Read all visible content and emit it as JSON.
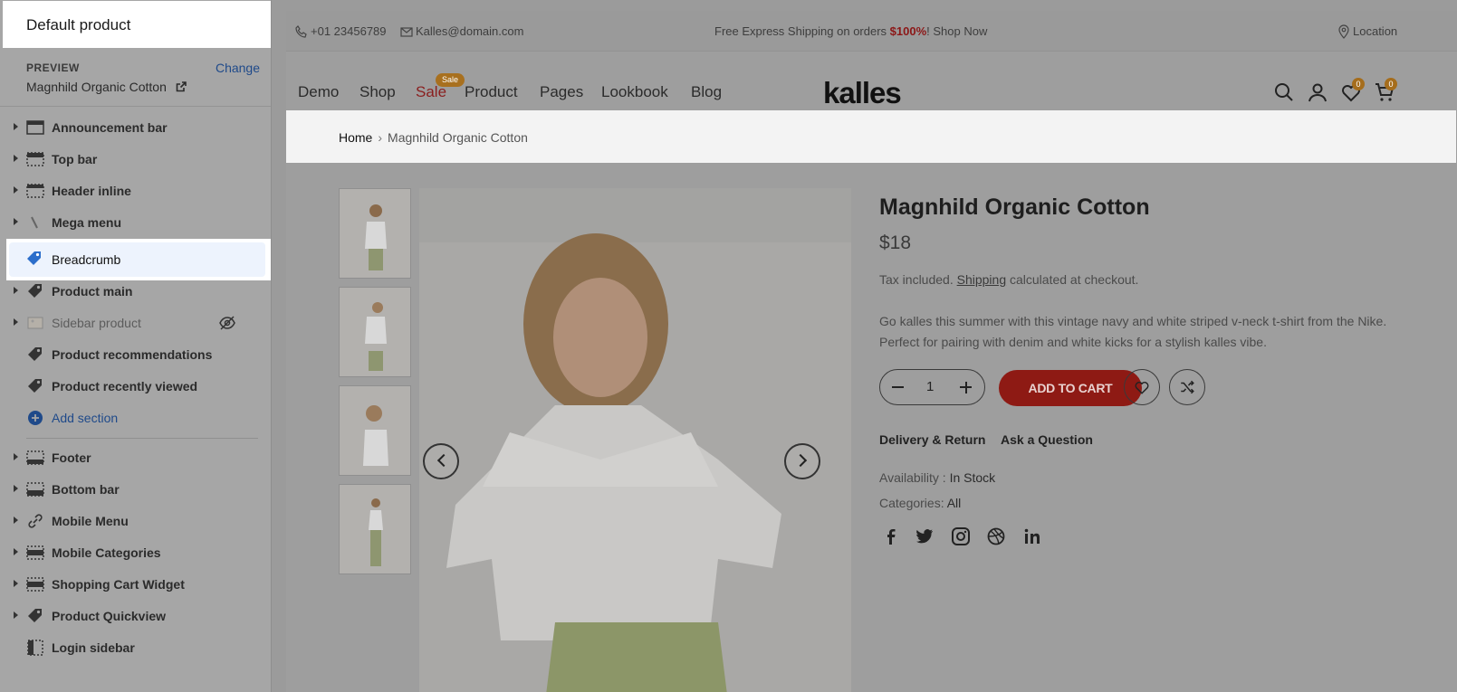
{
  "sidebar": {
    "title": "Default product",
    "preview_label": "PREVIEW",
    "change_label": "Change",
    "preview_value": "Magnhild Organic Cotton",
    "sections": [
      {
        "label": "Announcement bar",
        "icon": "layout-bar-icon"
      },
      {
        "label": "Top bar",
        "icon": "layout-bar-icon"
      },
      {
        "label": "Header inline",
        "icon": "layout-bar-icon"
      },
      {
        "label": "Mega menu",
        "icon": "brush-icon"
      },
      {
        "label": "Breadcrumb",
        "icon": "tag-icon"
      },
      {
        "label": "Product main",
        "icon": "tag-icon"
      },
      {
        "label": "Sidebar product",
        "icon": "image-icon"
      },
      {
        "label": "Product recommendations",
        "icon": "tag-icon"
      },
      {
        "label": "Product recently viewed",
        "icon": "tag-icon"
      },
      {
        "label": "Add section",
        "icon": "plus-circle-icon"
      },
      {
        "label": "Footer",
        "icon": "layout-bar-icon"
      },
      {
        "label": "Bottom bar",
        "icon": "layout-bar-icon"
      },
      {
        "label": "Mobile Menu",
        "icon": "link-icon"
      },
      {
        "label": "Mobile Categories",
        "icon": "layout-bar-icon"
      },
      {
        "label": "Shopping Cart Widget",
        "icon": "layout-bar-icon"
      },
      {
        "label": "Product Quickview",
        "icon": "tag-icon"
      },
      {
        "label": "Login sidebar",
        "icon": "sidebar-icon"
      }
    ]
  },
  "store": {
    "phone": "+01 23456789",
    "email": "Kalles@domain.com",
    "promo_prefix": "Free Express Shipping on orders ",
    "promo_highlight": "$100%",
    "promo_suffix": "! Shop Now",
    "location": "Location",
    "nav": [
      "Demo",
      "Shop",
      "Sale",
      "Product",
      "Pages",
      "Lookbook",
      "Blog"
    ],
    "sale_badge": "Sale",
    "logo": "kalles",
    "wishlist_count": "0",
    "cart_count": "0"
  },
  "breadcrumb": {
    "home": "Home",
    "separator": "›",
    "current": "Magnhild Organic Cotton"
  },
  "product": {
    "title": "Magnhild Organic Cotton",
    "price": "$18",
    "tax_prefix": "Tax included. ",
    "tax_link": "Shipping",
    "tax_suffix": " calculated at checkout.",
    "description": "Go kalles this summer with this vintage navy and white striped v-neck t-shirt from the Nike. Perfect for pairing with denim and white kicks for a stylish kalles vibe.",
    "quantity": "1",
    "add_to_cart": "ADD TO CART",
    "delivery_link": "Delivery & Return",
    "question_link": "Ask a Question",
    "availability_label": "Availability : ",
    "availability_value": "In Stock",
    "categories_label": "Categories: ",
    "categories_value": "All"
  },
  "colors": {
    "accent_red": "#8e1a14",
    "badge_amber": "#a8701f",
    "link_blue": "#1f4a8a",
    "overlay_gray": "#9e9e9e"
  }
}
